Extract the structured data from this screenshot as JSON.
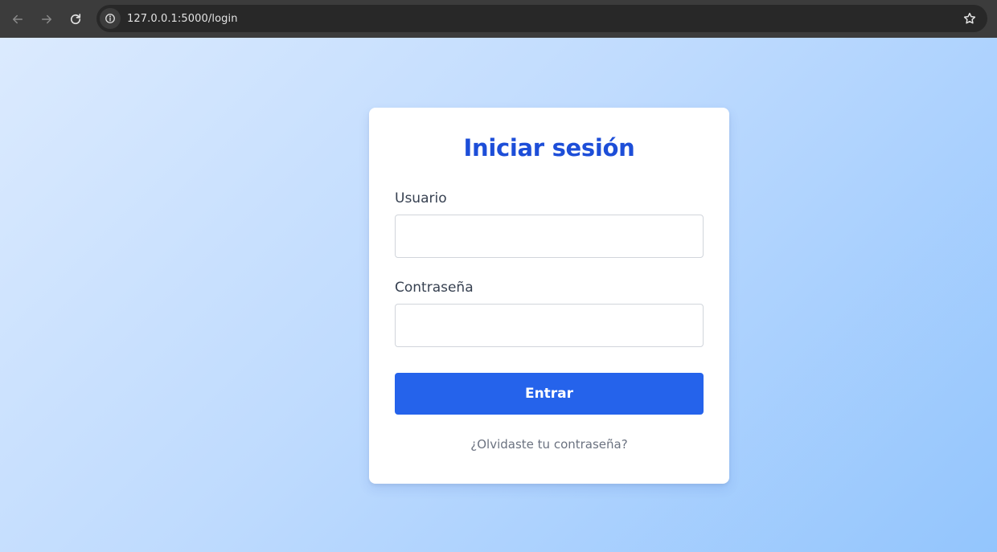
{
  "browser": {
    "url": "127.0.0.1:5000/login",
    "icons": {
      "back": "arrow-left-icon",
      "forward": "arrow-right-icon",
      "reload": "reload-icon",
      "site_info": "info-icon",
      "bookmark": "star-icon"
    }
  },
  "colors": {
    "accent": "#2563eb",
    "title": "#1d4ed8",
    "background_start": "#dbeafe",
    "background_end": "#93c5fd"
  },
  "login": {
    "title": "Iniciar sesión",
    "username_label": "Usuario",
    "username_value": "",
    "password_label": "Contraseña",
    "password_value": "",
    "submit_label": "Entrar",
    "forgot_label": "¿Olvidaste tu contraseña?"
  }
}
